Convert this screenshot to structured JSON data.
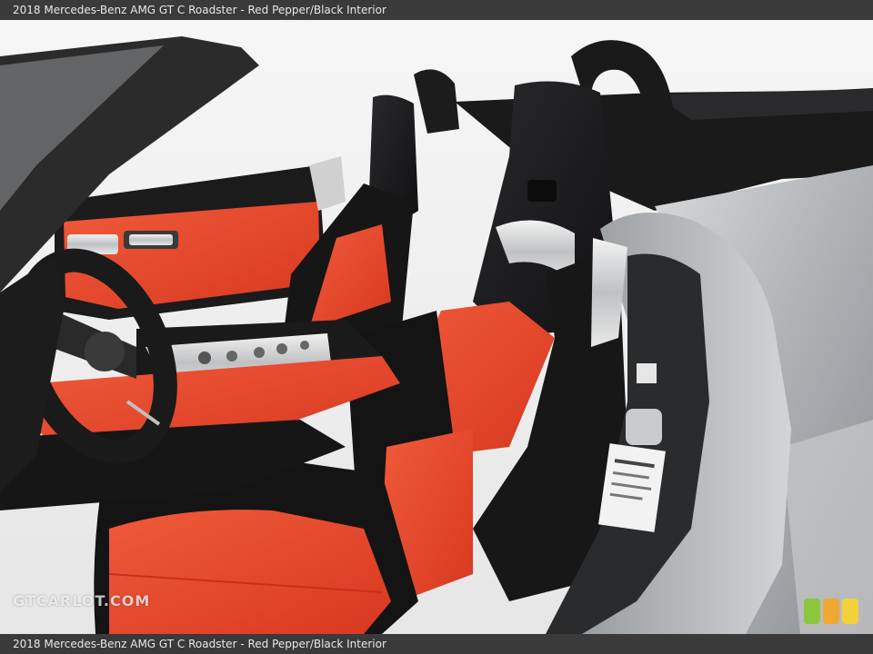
{
  "caption": {
    "top": "2018 Mercedes-Benz AMG GT C Roadster - Red Pepper/Black Interior",
    "bottom": "2018 Mercedes-Benz AMG GT C Roadster - Red Pepper/Black Interior"
  },
  "watermark": "GTCARLOT.COM",
  "colors": {
    "caption_bar": "#3a3a3a",
    "leather_red": "#e8442a",
    "leather_black": "#1c1c1e",
    "body_silver": "#b9bcbf",
    "badge_green": "#8cc63f",
    "badge_orange": "#f0a830",
    "badge_yellow": "#f2d23a"
  },
  "icons": [
    "steering-wheel",
    "seat",
    "door-label",
    "color-badge"
  ]
}
